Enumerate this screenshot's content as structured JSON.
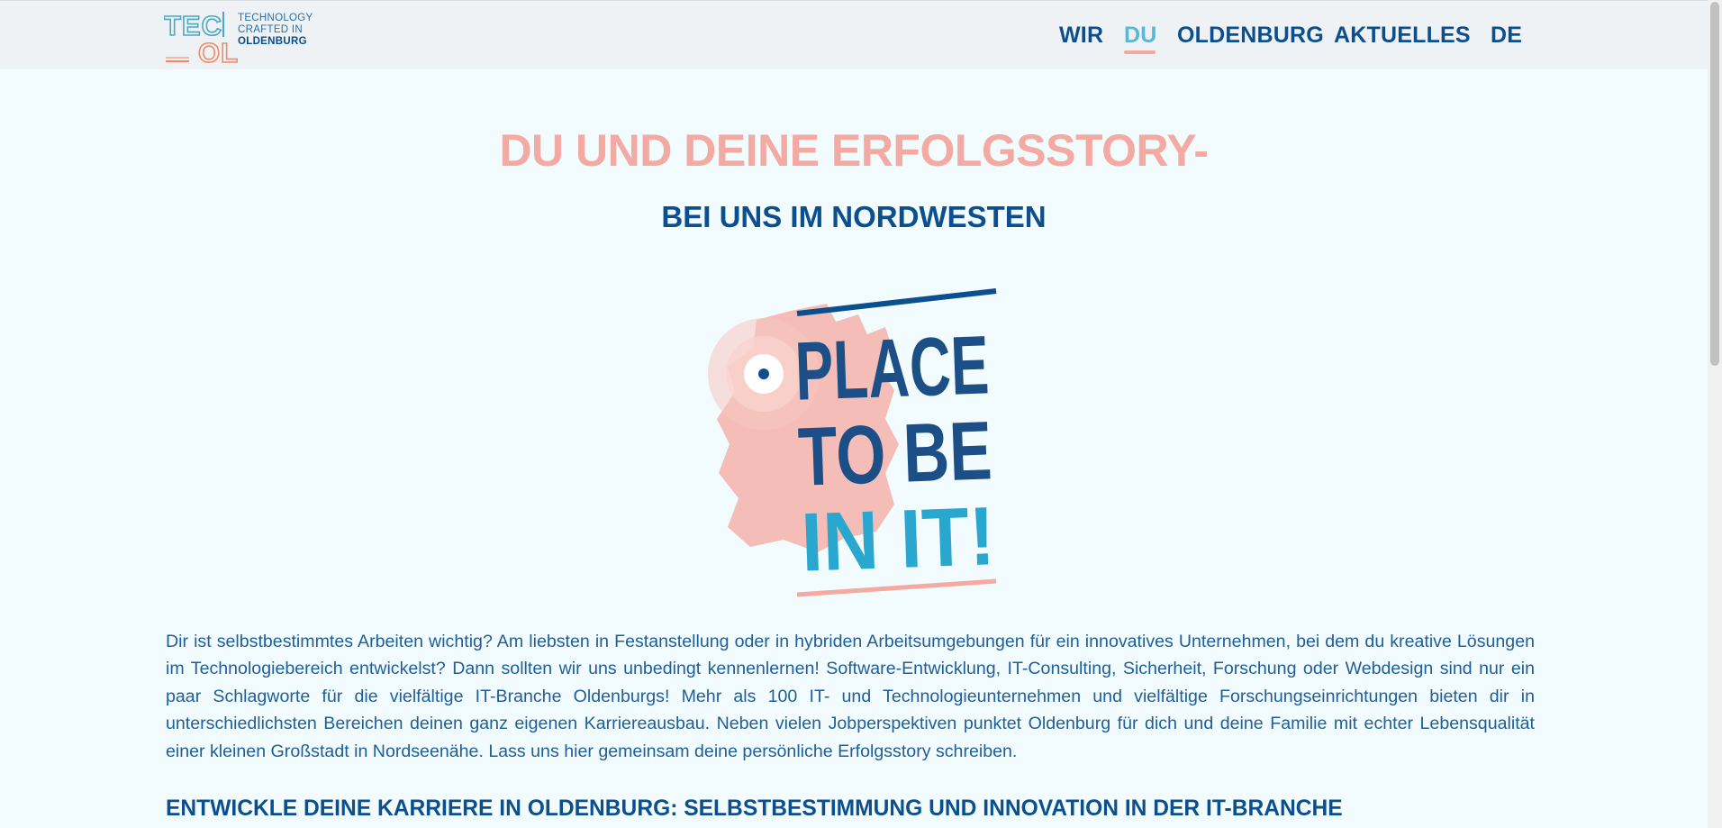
{
  "logo": {
    "mark_letters": [
      "TEC",
      "OL"
    ],
    "tagline": [
      "TECHNOLOGY",
      "CRAFTED IN",
      "OLDENBURG"
    ]
  },
  "nav": {
    "items": [
      {
        "label": "WIR"
      },
      {
        "label": "DU"
      },
      {
        "label": "OLDENBURG"
      },
      {
        "label": "AKTUELLES"
      },
      {
        "label": "DE"
      }
    ],
    "active": "DU"
  },
  "hero": {
    "title": "DU UND DEINE ERFOLGSSTORY-",
    "subtitle": "BEI UNS IM NORDWESTEN"
  },
  "illustration": {
    "lines": [
      "PLACE",
      "TO BE",
      "IN IT!"
    ]
  },
  "intro": {
    "text": "Dir ist selbstbestimmtes Arbeiten wichtig? Am liebsten in Festanstellung oder in hybriden Arbeitsumgebungen für ein innovatives Unternehmen, bei dem du kreative Lösungen im Technologiebereich entwickelst? Dann sollten wir uns unbedingt kennenlernen! Software-Entwicklung, IT-Consulting, Sicherheit, Forschung oder Webdesign sind nur ein paar Schlagworte für die vielfältige IT-Branche Oldenburgs! Mehr als 100 IT- und Technologieunternehmen und vielfältige Forschungseinrichtungen bieten dir in unterschiedlichsten Bereichen deinen ganz eigenen Karriereausbau. Neben vielen Jobperspektiven punktet Oldenburg für dich und deine Familie mit echter Lebensqualität einer kleinen Großstadt in Nordseenähe. Lass uns hier gemeinsam deine persönliche Erfolgsstory schreiben."
  },
  "section": {
    "heading": "ENTWICKLE DEINE KARRIERE IN OLDENBURG: SELBSTBESTIMMUNG UND INNOVATION IN DER IT-BRANCHE"
  },
  "colors": {
    "background": "#f2fbfd",
    "navy": "#0b4f8e",
    "light_blue": "#5cb6d6",
    "coral": "#f3aaa3"
  }
}
